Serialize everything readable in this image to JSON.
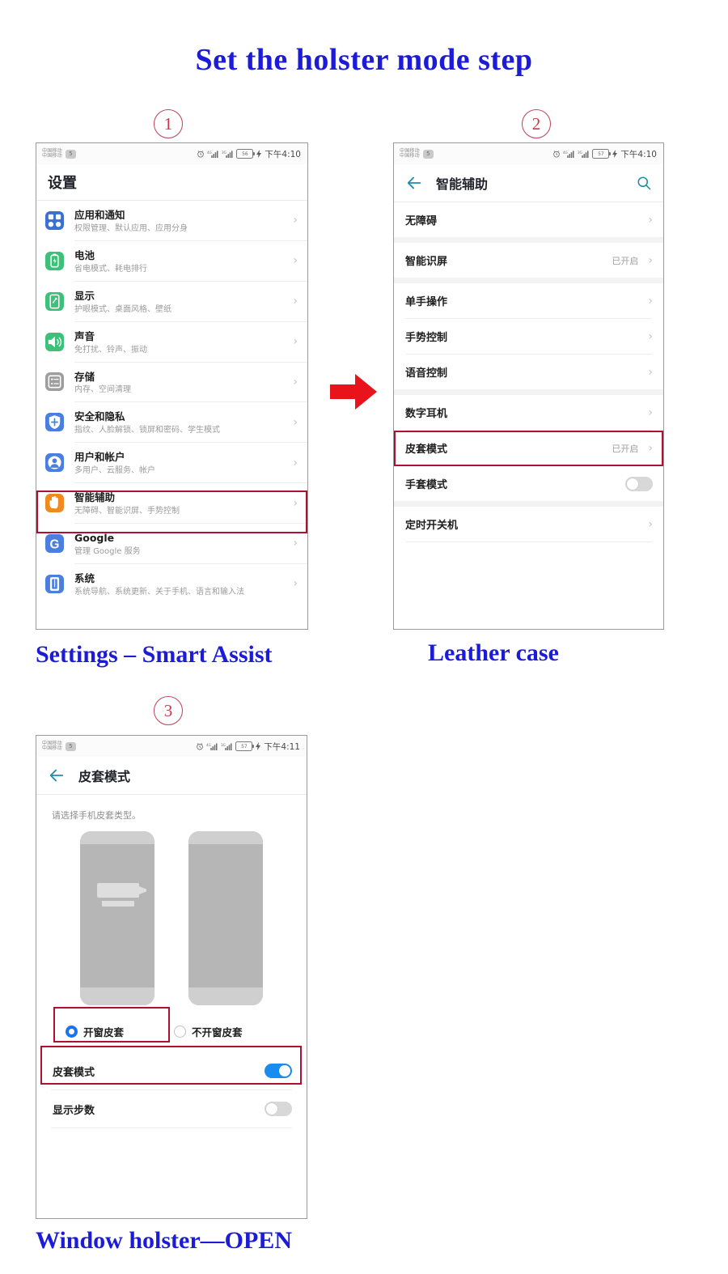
{
  "title": "Set the holster mode step",
  "steps": [
    {
      "num": "1",
      "caption": "Settings – Smart Assist"
    },
    {
      "num": "2",
      "caption": "Leather case"
    },
    {
      "num": "3",
      "caption": "Window holster––OPEN"
    }
  ],
  "arrow": {
    "name": "red-right-arrow",
    "color": "#e8131b"
  },
  "accent": {
    "highlight": "#b01030",
    "title_blue": "#1b1bd8",
    "toggle_on": "#1a8cf0",
    "radio_on": "#1a73e8"
  },
  "phone1": {
    "statusbar": {
      "carrier1": "中国移动",
      "carrier2": "中国移动",
      "sim_badge": "5",
      "alarm_icon": "alarm-icon",
      "signal1": "4G",
      "signal2": "3G",
      "battery": "56",
      "time": "下午4:10"
    },
    "app_title": "设置",
    "rows": [
      {
        "title": "应用和通知",
        "sub": "权限管理、默认应用、应用分身",
        "icon": "apps-icon",
        "color": "#3b6fd4"
      },
      {
        "title": "电池",
        "sub": "省电模式、耗电排行",
        "icon": "battery-icon",
        "color": "#3dc07a"
      },
      {
        "title": "显示",
        "sub": "护眼模式、桌面风格、壁纸",
        "icon": "display-icon",
        "color": "#3dc07a"
      },
      {
        "title": "声音",
        "sub": "免打扰、铃声、振动",
        "icon": "sound-icon",
        "color": "#3dc07a"
      },
      {
        "title": "存储",
        "sub": "内存、空间清理",
        "icon": "storage-icon",
        "color": "#9e9e9e"
      },
      {
        "title": "安全和隐私",
        "sub": "指纹、人脸解锁、锁屏和密码、学生模式",
        "icon": "shield-icon",
        "color": "#4a7fe0"
      },
      {
        "title": "用户和帐户",
        "sub": "多用户、云服务、帐户",
        "icon": "user-icon",
        "color": "#4a7fe0"
      },
      {
        "title": "智能辅助",
        "sub": "无障碍、智能识屏、手势控制",
        "icon": "hand-icon",
        "color": "#f08a1e"
      },
      {
        "title": "Google",
        "sub": "管理 Google 服务",
        "icon": "google-icon",
        "color": "#4a7fe0"
      },
      {
        "title": "系统",
        "sub": "系统导航、系统更新、关于手机、语言和输入法",
        "icon": "system-icon",
        "color": "#4a7fe0"
      }
    ],
    "highlighted_row": "智能辅助"
  },
  "phone2": {
    "statusbar": {
      "carrier1": "中国移动",
      "carrier2": "中国移动",
      "sim_badge": "5",
      "battery": "57",
      "time": "下午4:10"
    },
    "app_title": "智能辅助",
    "back_icon": "back-arrow-icon",
    "search_icon": "search-icon",
    "rows": [
      {
        "title": "无障碍",
        "value": "",
        "control": "chevron"
      },
      {
        "title": "智能识屏",
        "value": "已开启",
        "control": "chevron"
      },
      {
        "title": "单手操作",
        "value": "",
        "control": "chevron"
      },
      {
        "title": "手势控制",
        "value": "",
        "control": "chevron"
      },
      {
        "title": "语音控制",
        "value": "",
        "control": "chevron"
      },
      {
        "title": "数字耳机",
        "value": "",
        "control": "chevron"
      },
      {
        "title": "皮套模式",
        "value": "已开启",
        "control": "chevron"
      },
      {
        "title": "手套模式",
        "value": "",
        "control": "toggle-off"
      },
      {
        "title": "定时开关机",
        "value": "",
        "control": "chevron"
      }
    ],
    "highlighted_row": "皮套模式"
  },
  "phone3": {
    "statusbar": {
      "carrier1": "中国移动",
      "carrier2": "中国移动",
      "sim_badge": "5",
      "battery": "57",
      "time": "下午4:11"
    },
    "app_title": "皮套模式",
    "back_icon": "back-arrow-icon",
    "hint": "请选择手机皮套类型。",
    "options": [
      {
        "label": "开窗皮套",
        "selected": true,
        "illustration": "phone-with-window"
      },
      {
        "label": "不开窗皮套",
        "selected": false,
        "illustration": "phone-plain"
      }
    ],
    "rows": [
      {
        "title": "皮套模式",
        "toggle": "on"
      },
      {
        "title": "显示步数",
        "toggle": "off"
      }
    ],
    "highlighted": [
      "开窗皮套",
      "皮套模式"
    ]
  }
}
